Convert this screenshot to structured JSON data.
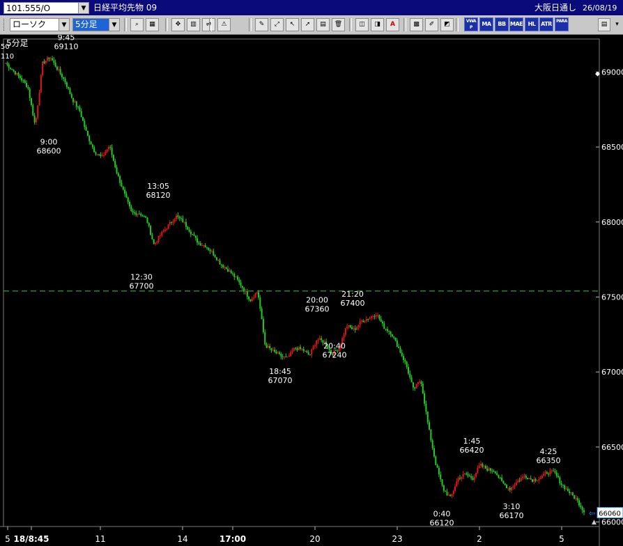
{
  "window": {
    "symbol_field": "101.555/O",
    "instrument_title": "日経平均先物 09",
    "market": "大阪日通し",
    "date": "26/08/19"
  },
  "toolbar": {
    "chart_style": "ローソク",
    "interval": "5分足",
    "indicators": [
      "VWAP",
      "MA",
      "BB",
      "MAE",
      "HL",
      "ATR",
      "PARA"
    ],
    "icons": [
      "zoom-icon",
      "grid-icon",
      "candle-shape-icon",
      "volume-icon",
      "split-icon",
      "fib-icon",
      "pencil-icon",
      "line-tool-icon",
      "cursor-icon",
      "arrow-tool-icon",
      "memo-icon",
      "trash-icon",
      "candle-select-icon",
      "candle-adjust-icon",
      "all-icon",
      "settings-icon",
      "tool-icon",
      "palette-icon"
    ],
    "colors": {
      "bar": "#c8c8c8",
      "indicator_bg": "#1a2fa8",
      "title_bg": "#0a0a7a"
    }
  },
  "chart_data": {
    "type": "candlestick",
    "interval_label": "5分足",
    "top_left_labels": [
      "50",
      "110"
    ],
    "ylim": [
      65970,
      69220
    ],
    "y_ticks": [
      66000,
      66500,
      67000,
      67500,
      68000,
      68500,
      69000
    ],
    "x_tick_labels": [
      {
        "label": "5",
        "bold": false
      },
      {
        "label": "18/8:45",
        "bold": true
      },
      {
        "label": "11",
        "bold": false
      },
      {
        "label": "14",
        "bold": false
      },
      {
        "label": "17:00",
        "bold": true
      },
      {
        "label": "20",
        "bold": false
      },
      {
        "label": "23",
        "bold": false
      },
      {
        "label": "2",
        "bold": false
      },
      {
        "label": "5",
        "bold": false
      }
    ],
    "reference_line": 67540,
    "last_price": 66060,
    "colors": {
      "up": "#e01818",
      "down": "#22cc22",
      "reference": "#2aa02a",
      "last_marker": "#ffffff",
      "background": "#000000",
      "frame": "#7a7a7a"
    },
    "annotations": [
      {
        "time": "9:45",
        "value": 69110,
        "position": "above"
      },
      {
        "time": "9:00",
        "value": 68600,
        "position": "below"
      },
      {
        "time": "13:05",
        "value": 68120,
        "position": "above"
      },
      {
        "time": "12:30",
        "value": 67700,
        "position": "below"
      },
      {
        "time": "20:00",
        "value": 67360,
        "position": "above"
      },
      {
        "time": "21:20",
        "value": 67400,
        "position": "above"
      },
      {
        "time": "18:45",
        "value": 67070,
        "position": "below"
      },
      {
        "time": "20:40",
        "value": 67240,
        "position": "below"
      },
      {
        "time": "1:45",
        "value": 66420,
        "position": "above"
      },
      {
        "time": "0:40",
        "value": 66120,
        "position": "below"
      },
      {
        "time": "3:10",
        "value": 66170,
        "position": "below"
      },
      {
        "time": "4:25",
        "value": 66350,
        "position": "above"
      }
    ],
    "close_path": [
      69060,
      69010,
      68960,
      68900,
      68640,
      69060,
      69100,
      69020,
      68940,
      68820,
      68740,
      68580,
      68470,
      68430,
      68510,
      68330,
      68190,
      68060,
      68060,
      68020,
      67850,
      67920,
      67980,
      68040,
      68000,
      67930,
      67860,
      67840,
      67790,
      67720,
      67680,
      67630,
      67560,
      67480,
      67540,
      67180,
      67140,
      67110,
      67090,
      67160,
      67150,
      67110,
      67220,
      67200,
      67120,
      67160,
      67310,
      67280,
      67340,
      67360,
      67390,
      67300,
      67260,
      67160,
      67050,
      66880,
      66950,
      66640,
      66390,
      66220,
      66160,
      66290,
      66320,
      66290,
      66380,
      66350,
      66340,
      66260,
      66220,
      66270,
      66310,
      66280,
      66290,
      66330,
      66330,
      66250,
      66200,
      66150,
      66070
    ]
  }
}
